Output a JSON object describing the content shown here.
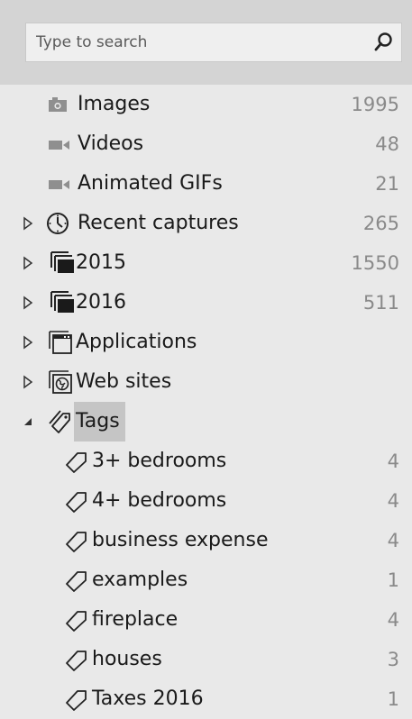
{
  "search": {
    "placeholder": "Type to search",
    "value": ""
  },
  "tree": {
    "media": [
      {
        "label": "Images",
        "count": "1995",
        "icon": "camera-icon"
      },
      {
        "label": "Videos",
        "count": "48",
        "icon": "video-icon"
      },
      {
        "label": "Animated GIFs",
        "count": "21",
        "icon": "video-icon"
      }
    ],
    "groups": [
      {
        "label": "Recent captures",
        "count": "265",
        "icon": "clock-icon"
      },
      {
        "label": "2015",
        "count": "1550",
        "icon": "folder-stack-icon"
      },
      {
        "label": "2016",
        "count": "511",
        "icon": "folder-stack-icon"
      },
      {
        "label": "Applications",
        "count": "",
        "icon": "window-icon"
      },
      {
        "label": "Web sites",
        "count": "",
        "icon": "globe-icon"
      }
    ],
    "tags_label": "Tags",
    "tags": [
      {
        "label": "3+ bedrooms",
        "count": "4"
      },
      {
        "label": "4+ bedrooms",
        "count": "4"
      },
      {
        "label": "business expense",
        "count": "4"
      },
      {
        "label": "examples",
        "count": "1"
      },
      {
        "label": "fireplace",
        "count": "4"
      },
      {
        "label": "houses",
        "count": "3"
      },
      {
        "label": "Taxes 2016",
        "count": "1"
      }
    ]
  }
}
